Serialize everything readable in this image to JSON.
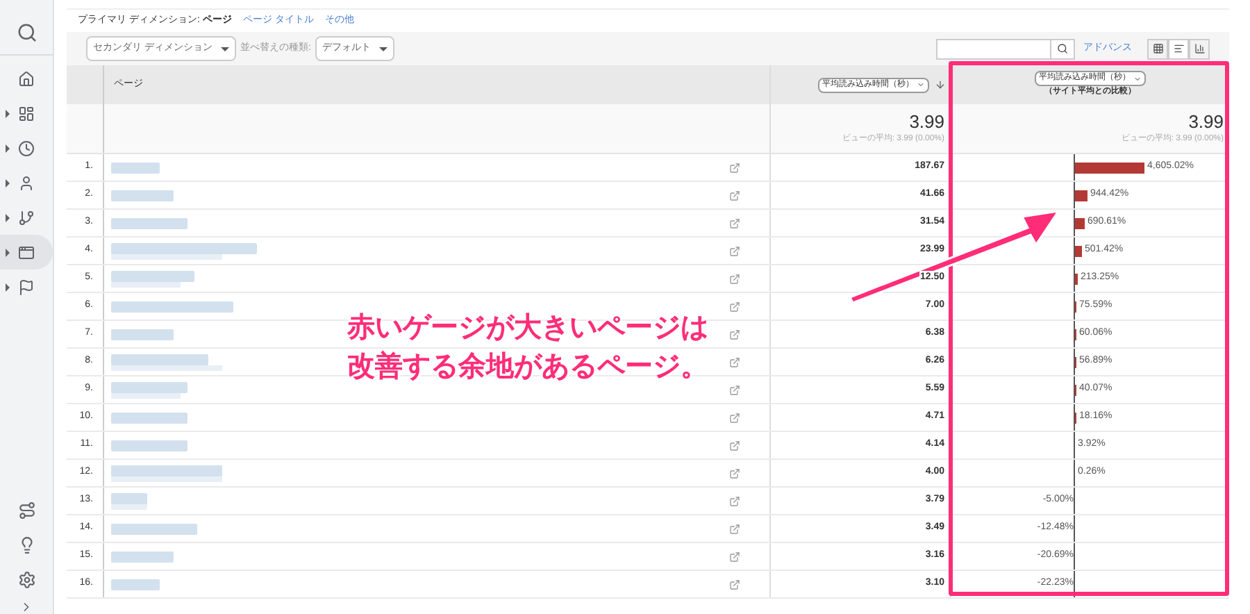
{
  "sidebar": {
    "items": [
      {
        "kind": "home",
        "selected": false
      },
      {
        "kind": "dashboard",
        "selected": false
      },
      {
        "kind": "clock",
        "selected": false
      },
      {
        "kind": "person",
        "selected": false
      },
      {
        "kind": "branch",
        "selected": false
      },
      {
        "kind": "window",
        "selected": true
      },
      {
        "kind": "flag",
        "selected": false
      }
    ]
  },
  "dimension_bar": {
    "label": "プライマリ ディメンション:",
    "options": [
      {
        "label": "ページ",
        "selected": true
      },
      {
        "label": "ページ タイトル",
        "selected": false
      },
      {
        "label": "その他",
        "selected": false
      }
    ]
  },
  "toolbar": {
    "secondary_dimension": "セカンダリ ディメンション",
    "sort_label": "並べ替えの種類:",
    "sort_value": "デフォルト",
    "advanced_link": "アドバンス",
    "views": [
      {
        "kind": "table",
        "selected": false
      },
      {
        "kind": "comparison",
        "selected": true
      },
      {
        "kind": "pivot",
        "selected": false
      }
    ]
  },
  "table": {
    "columns": [
      {
        "label": "ページ"
      },
      {
        "label": "平均読み込み時間（秒）"
      },
      {
        "label": "平均読み込み時間（秒）",
        "subtitle": "（サイト平均との比較）"
      }
    ],
    "summary": [
      {
        "value": "3.99",
        "note": "ビューの平均: 3.99 (0.00%)"
      },
      {
        "value": "3.99",
        "note": "ビューの平均: 3.99 (0.00%)"
      }
    ],
    "rows": [
      {
        "index": "1.",
        "value": "187.67",
        "comparison": "4,605.02%",
        "kind": "above"
      },
      {
        "index": "2.",
        "value": "41.66",
        "comparison": "944.42%",
        "kind": "above"
      },
      {
        "index": "3.",
        "value": "31.54",
        "comparison": "690.61%",
        "kind": "above"
      },
      {
        "index": "4.",
        "value": "23.99",
        "comparison": "501.42%",
        "kind": "above"
      },
      {
        "index": "5.",
        "value": "12.50",
        "comparison": "213.25%",
        "kind": "above"
      },
      {
        "index": "6.",
        "value": "7.00",
        "comparison": "75.59%",
        "kind": "above"
      },
      {
        "index": "7.",
        "value": "6.38",
        "comparison": "60.06%",
        "kind": "above"
      },
      {
        "index": "8.",
        "value": "6.26",
        "comparison": "56.89%",
        "kind": "above"
      },
      {
        "index": "9.",
        "value": "5.59",
        "comparison": "40.07%",
        "kind": "above"
      },
      {
        "index": "10.",
        "value": "4.71",
        "comparison": "18.16%",
        "kind": "above"
      },
      {
        "index": "11.",
        "value": "4.14",
        "comparison": "3.92%",
        "kind": "above"
      },
      {
        "index": "12.",
        "value": "4.00",
        "comparison": "0.26%",
        "kind": "above"
      },
      {
        "index": "13.",
        "value": "3.79",
        "comparison": "-5.00%",
        "kind": "below"
      },
      {
        "index": "14.",
        "value": "3.49",
        "comparison": "-12.48%",
        "kind": "below"
      },
      {
        "index": "15.",
        "value": "3.16",
        "comparison": "-20.69%",
        "kind": "below"
      },
      {
        "index": "16.",
        "value": "3.10",
        "comparison": "-22.23%",
        "kind": "below"
      }
    ]
  },
  "annotation": {
    "lines": [
      "赤いゲージが大きいページは",
      "改善する余地があるページ。"
    ]
  }
}
